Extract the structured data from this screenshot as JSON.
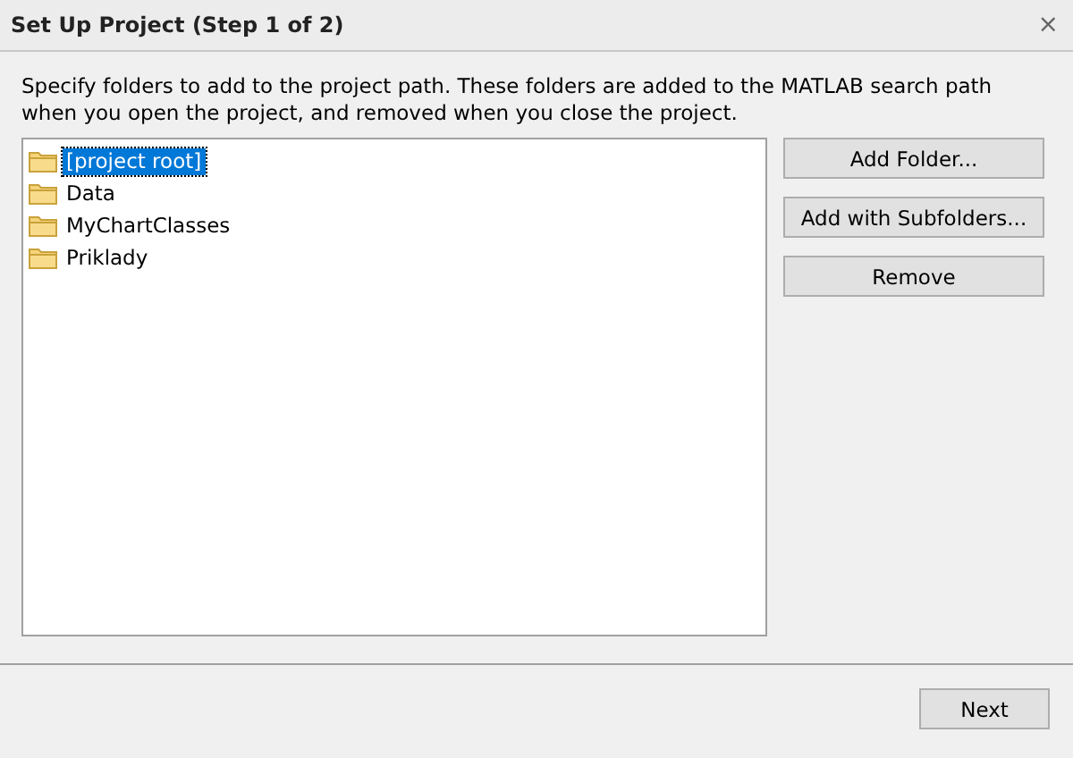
{
  "window": {
    "title": "Set Up Project (Step 1 of 2)",
    "close": "×"
  },
  "description": "Specify folders to add to the project path. These folders are added to the MATLAB search path when you open the project, and removed when you close the project.",
  "folders": [
    {
      "name": "[project root]",
      "selected": true
    },
    {
      "name": "Data",
      "selected": false
    },
    {
      "name": "MyChartClasses",
      "selected": false
    },
    {
      "name": "Priklady",
      "selected": false
    }
  ],
  "side_buttons": [
    "Add Folder...",
    "Add with Subfolders...",
    "Remove"
  ],
  "footer_buttons": [
    "Next"
  ]
}
